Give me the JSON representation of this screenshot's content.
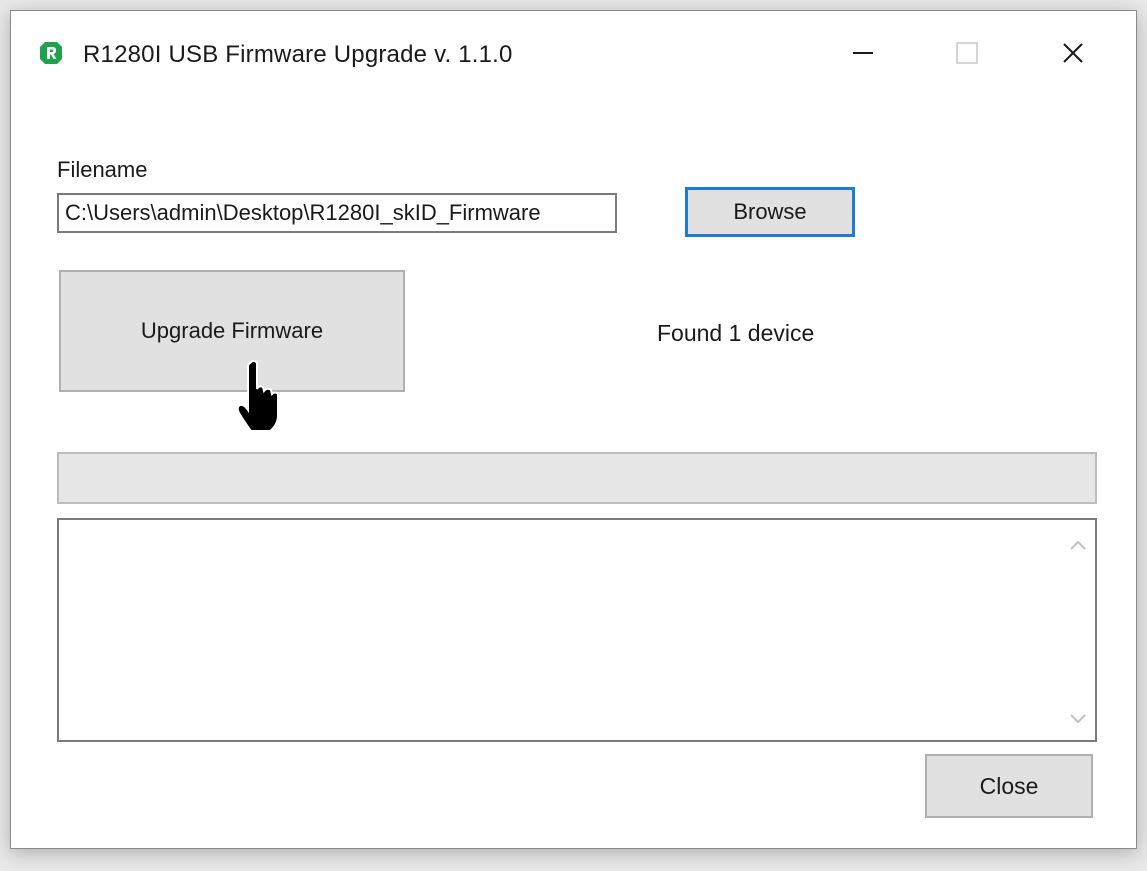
{
  "window": {
    "title": "R1280I USB Firmware Upgrade v. 1.1.0",
    "app_icon": "app-logo-icon",
    "accent_color": "#1f7ad4",
    "icon_color": "#1fa34a"
  },
  "titlebar_controls": {
    "minimize_icon": "minimize-icon",
    "maximize_icon": "maximize-icon",
    "close_icon": "close-icon"
  },
  "form": {
    "filename_label": "Filename",
    "filename_value": "C:\\Users\\admin\\Desktop\\R1280I_skID_Firmware",
    "browse_label": "Browse",
    "upgrade_label": "Upgrade Firmware",
    "status_text": "Found 1 device"
  },
  "progress": {
    "value": 0
  },
  "log": {
    "text": ""
  },
  "footer": {
    "close_label": "Close"
  },
  "cursor": {
    "icon": "hand-pointer-icon"
  }
}
